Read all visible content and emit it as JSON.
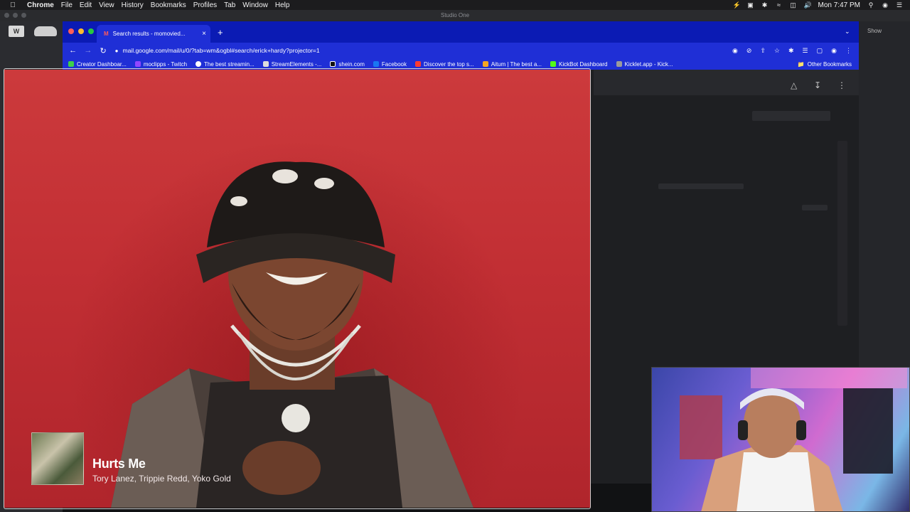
{
  "menubar": {
    "app": "Chrome",
    "items": [
      "File",
      "Edit",
      "View",
      "History",
      "Bookmarks",
      "Profiles",
      "Tab",
      "Window",
      "Help"
    ],
    "clock": "Mon 7:47 PM"
  },
  "studio": {
    "window_title": "Studio One",
    "show_label": "Show"
  },
  "chrome": {
    "tab_title": "Search results - momovied...",
    "url": "mail.google.com/mail/u/0/?tab=wm&ogbl#search/erick+hardy?projector=1",
    "bookmarks": [
      {
        "label": "Creator Dashboar...",
        "color": "#3ecf4a"
      },
      {
        "label": "moclipps - Twitch",
        "color": "#9146ff"
      },
      {
        "label": "The best streamin...",
        "color": "#ffffff"
      },
      {
        "label": "StreamElements -...",
        "color": "#ffffff"
      },
      {
        "label": "shein.com",
        "color": "#000000"
      },
      {
        "label": "Facebook",
        "color": "#1877f2"
      },
      {
        "label": "Discover the top s...",
        "color": "#ff3b30"
      },
      {
        "label": "Aitum | The best a...",
        "color": "#f5a623"
      },
      {
        "label": "KickBot Dashboard",
        "color": "#53fc18"
      },
      {
        "label": "Kicklet.app - Kick...",
        "color": "#9b9b9b"
      }
    ],
    "other_bookmarks": "Other Bookmarks"
  },
  "now_playing": {
    "title": "Hurts Me",
    "artists": "Tory Lanez, Trippie Redd, Yoko Gold"
  },
  "colors": {
    "chrome_blue": "#1f2fd6",
    "tabstrip_blue": "#0b1bb4",
    "projector_red": "#c22f34"
  }
}
